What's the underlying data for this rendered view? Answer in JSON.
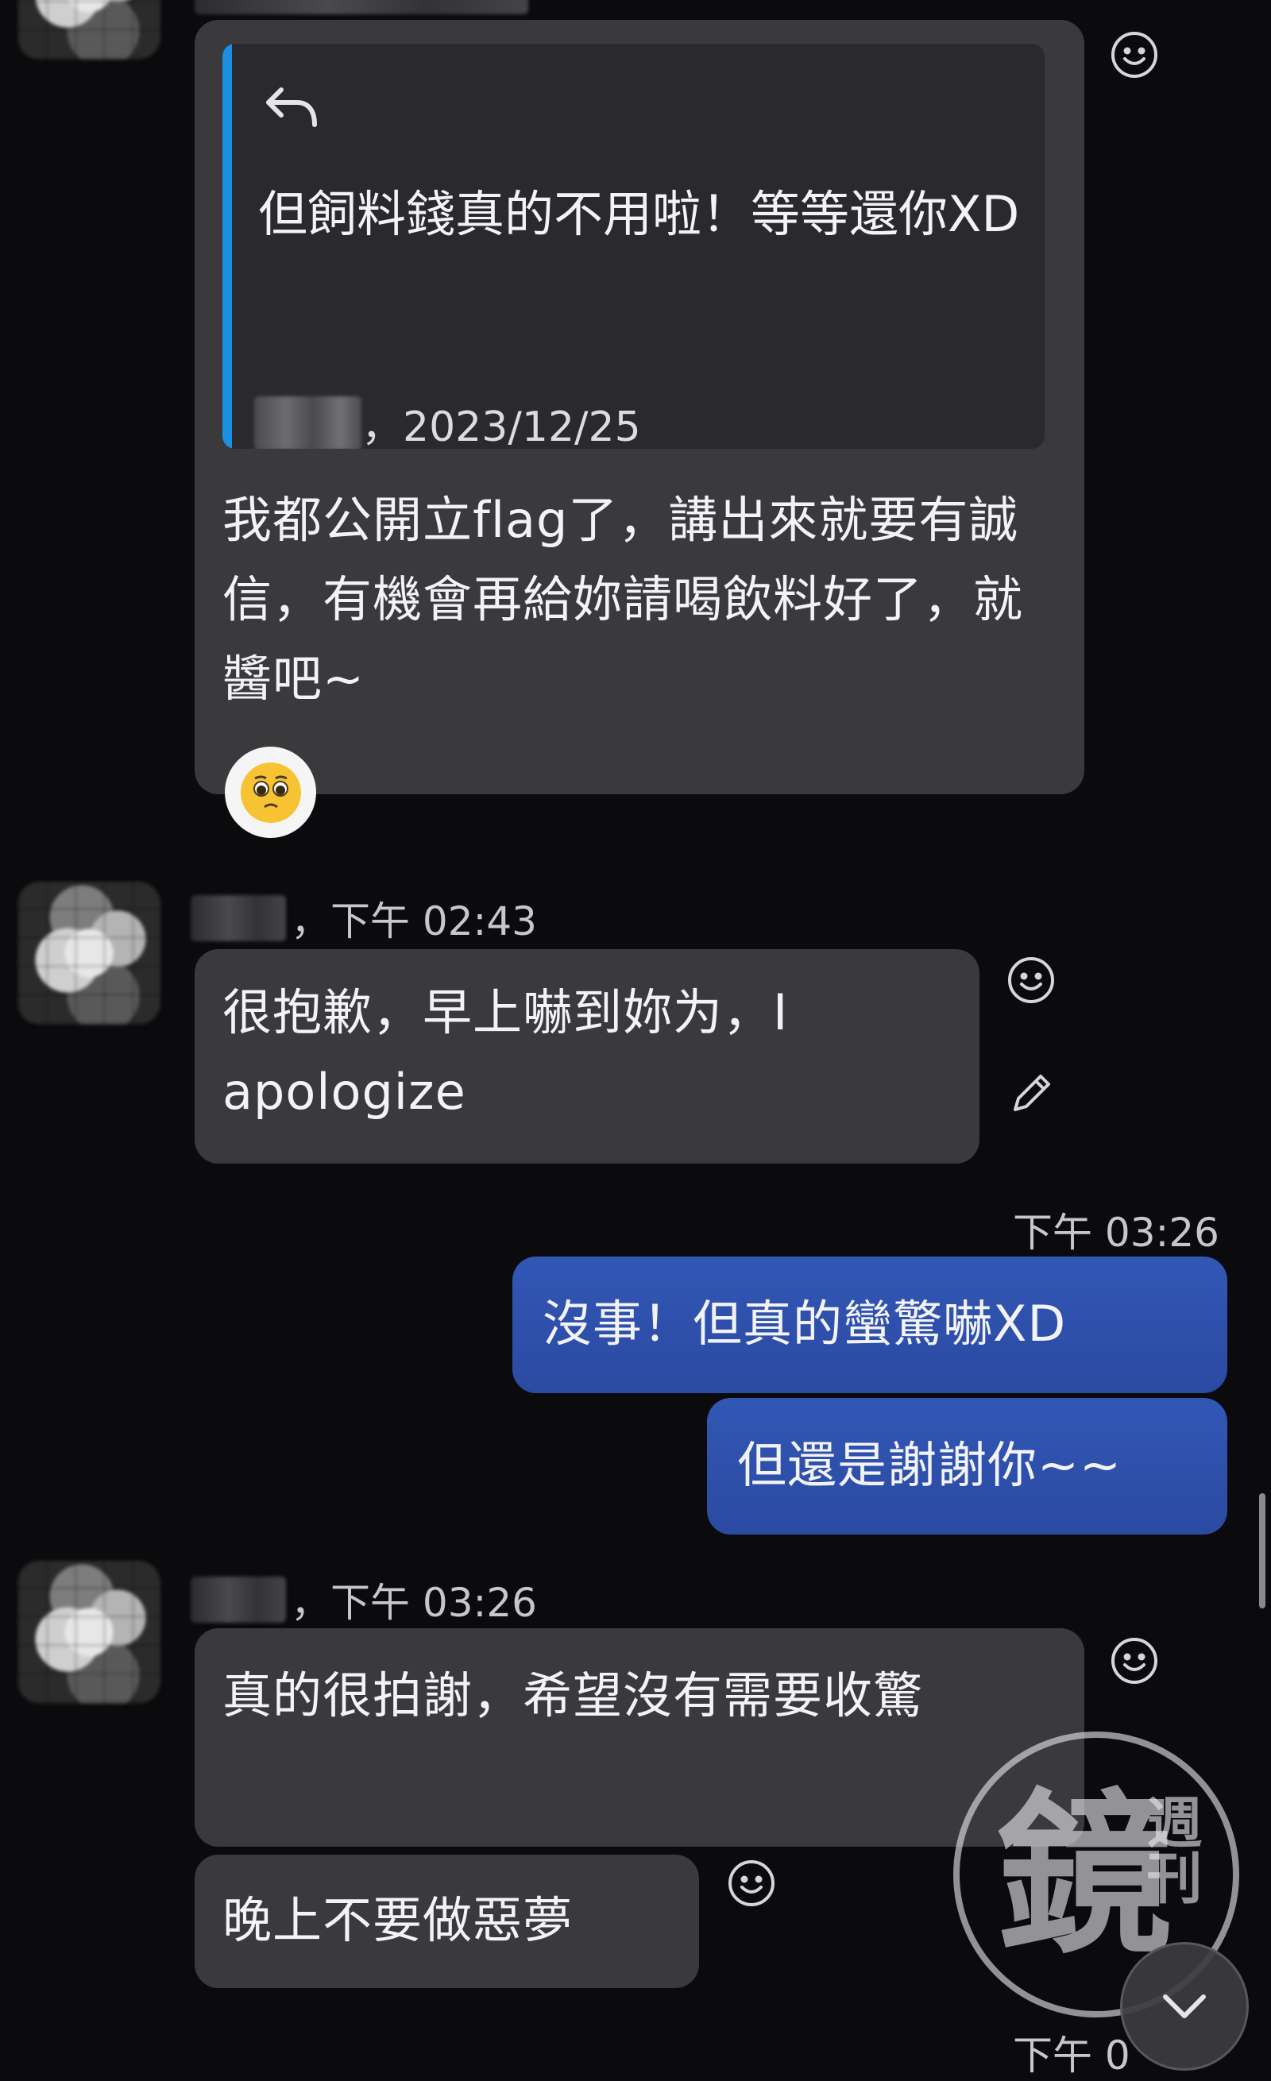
{
  "messages": {
    "quoted_reply": {
      "quote_text": "但飼料錢真的不用啦！等等還你XD",
      "quote_date": "，2023/12/25",
      "body": "我都公開立flag了，講出來就要有誠信，有機會再給妳請喝飲料好了，就醬吧~"
    },
    "group2": {
      "time": "，下午 02:43",
      "text": "很抱歉，早上嚇到妳为，I apologize"
    },
    "mine": {
      "time": "下午 03:26",
      "line1": "沒事！但真的蠻驚嚇XD",
      "line2": "但還是謝謝你~~"
    },
    "group3": {
      "time": "，下午 03:26",
      "text1": "真的很拍謝，希望沒有需要收驚",
      "text2": "晚上不要做惡夢"
    },
    "partial_time": "下午 0"
  },
  "watermark": {
    "big_char": "鏡",
    "small_chars": "週刊"
  },
  "icons": {
    "reply": "reply-arrow-icon",
    "react": "smiley-icon",
    "edit": "pencil-icon",
    "reaction_emoji": "pleading-face-emoji",
    "scroll_down": "chevron-down-icon"
  },
  "colors": {
    "background": "#0b0b0d",
    "bubble_other": "#3a3a3d",
    "bubble_mine": "#2d4fa6",
    "quote_bar": "#1d8fe0"
  }
}
